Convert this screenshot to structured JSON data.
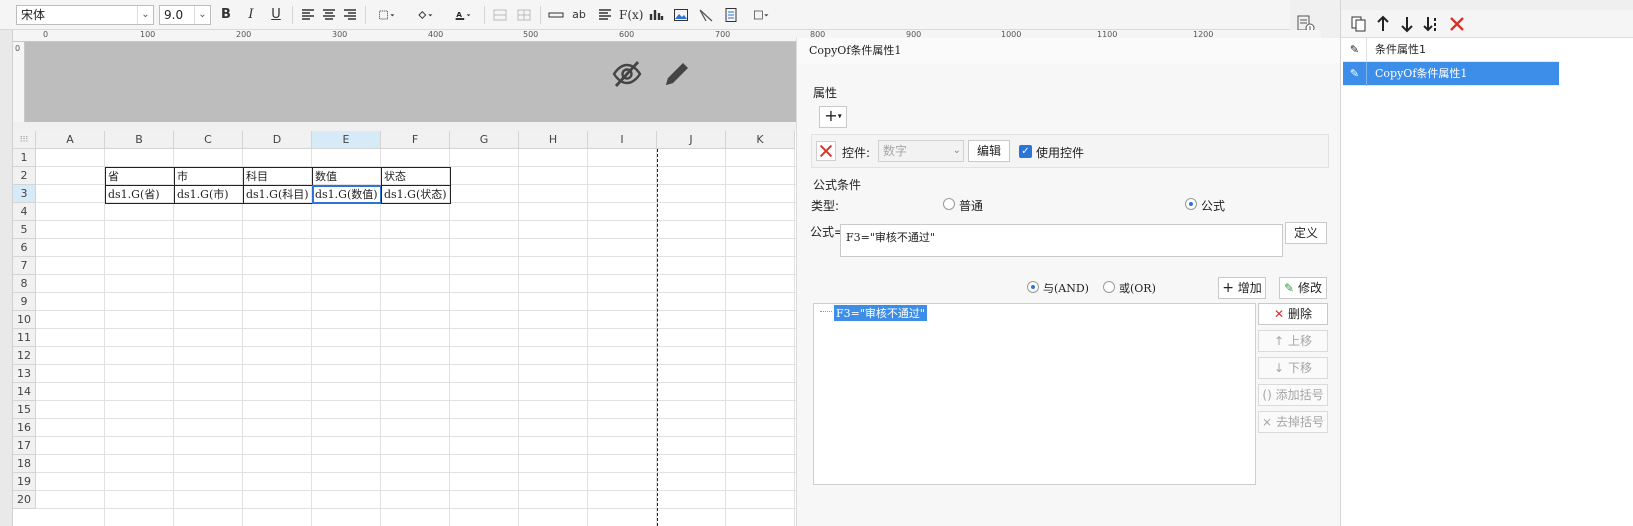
{
  "toolbar": {
    "font_name": "宋体",
    "font_size": "9.0",
    "bold": "B",
    "italic": "I",
    "underline": "U",
    "text_ab": "ab",
    "fx": "F(x)"
  },
  "ruler": {
    "labels": [
      "0",
      "100",
      "200",
      "300",
      "400",
      "500",
      "600",
      "700",
      "800",
      "900",
      "1000",
      "1100",
      "1200"
    ],
    "vertical_zero": "0"
  },
  "grid": {
    "columns": [
      "A",
      "B",
      "C",
      "D",
      "E",
      "F",
      "G",
      "H",
      "I",
      "J",
      "K"
    ],
    "rows": [
      "1",
      "2",
      "3",
      "4",
      "5",
      "6",
      "7",
      "8",
      "9",
      "10",
      "11",
      "12",
      "13",
      "14",
      "15",
      "16",
      "17",
      "18",
      "19",
      "20"
    ],
    "selected_column": "E",
    "selected_row": "3",
    "header_row": [
      "省",
      "市",
      "科目",
      "数值",
      "状态"
    ],
    "data_row": [
      "ds1.G(省)",
      "ds1.G(市)",
      "ds1.G(科目)",
      "ds1.G(数值)",
      "ds1.G(状态)"
    ]
  },
  "dialog": {
    "title": "CopyOf条件属性1",
    "properties_label": "属性",
    "add_symbol": "+",
    "widget_label": "控件:",
    "widget_select": "数字",
    "edit_button": "编辑",
    "use_widget_label": "使用控件",
    "use_widget_checked": true,
    "formula_section_label": "公式条件",
    "type_label": "类型:",
    "type_normal": "普通",
    "type_formula": "公式",
    "type_selected": "公式",
    "formula_label": "公式=",
    "formula_value": "F3=\"审核不通过\"",
    "define_button": "定义",
    "and_label": "与(AND)",
    "or_label": "或(OR)",
    "logic_selected": "与(AND)",
    "add_button": "增加",
    "modify_button": "修改",
    "condition_items": [
      "F3=\"审核不通过\""
    ],
    "delete_button": "删除",
    "move_up_button": "上移",
    "move_down_button": "下移",
    "add_bracket_button": "添加括号",
    "remove_bracket_button": "去掉括号"
  },
  "condition_list": {
    "items": [
      "条件属性1",
      "CopyOf条件属性1"
    ],
    "selected_index": 1
  },
  "colors": {
    "accent": "#2b74d8",
    "selection": "#3c8ee8",
    "danger": "#d9332a"
  }
}
